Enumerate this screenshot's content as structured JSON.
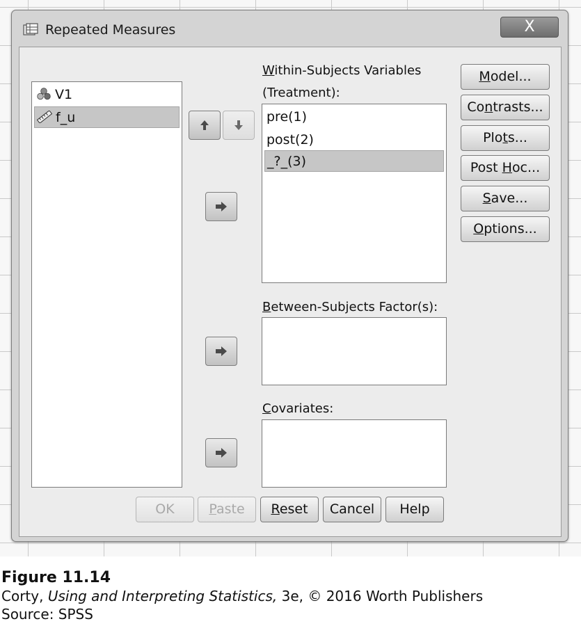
{
  "window": {
    "title": "Repeated Measures",
    "close_glyph": "X"
  },
  "source_list": {
    "items": [
      {
        "label": "V1",
        "icon": "nominal-variable-icon",
        "selected": false
      },
      {
        "label": "f_u",
        "icon": "scale-variable-icon",
        "selected": true
      }
    ]
  },
  "within_subjects": {
    "label_first": "W",
    "label_rest": "ithin-Subjects Variables",
    "sublabel": "(Treatment):",
    "items": [
      {
        "label": "pre(1)",
        "selected": false
      },
      {
        "label": "post(2)",
        "selected": false
      },
      {
        "label": "_?_(3)",
        "selected": true
      }
    ]
  },
  "between_subjects": {
    "label_first": "B",
    "label_rest": "etween-Subjects Factor(s):"
  },
  "covariates": {
    "label_first": "C",
    "label_rest": "ovariates:"
  },
  "side_buttons": {
    "model": {
      "pre": "",
      "u": "M",
      "post": "odel..."
    },
    "contrasts": {
      "pre": "Co",
      "u": "n",
      "post": "trasts..."
    },
    "plots": {
      "pre": "Plo",
      "u": "t",
      "post": "s..."
    },
    "posthoc": {
      "pre": "Post ",
      "u": "H",
      "post": "oc..."
    },
    "save": {
      "pre": "",
      "u": "S",
      "post": "ave..."
    },
    "options": {
      "pre": "",
      "u": "O",
      "post": "ptions..."
    }
  },
  "bottom_buttons": {
    "ok": "OK",
    "paste": {
      "pre": "",
      "u": "P",
      "post": "aste"
    },
    "reset": {
      "pre": "",
      "u": "R",
      "post": "eset"
    },
    "cancel": "Cancel",
    "help": "Help"
  },
  "caption": {
    "figure": "Figure 11.14",
    "author": "Corty, ",
    "book": "Using and Interpreting Statistics,",
    "rest": " 3e, © 2016 Worth Publishers",
    "source": "Source: SPSS"
  }
}
